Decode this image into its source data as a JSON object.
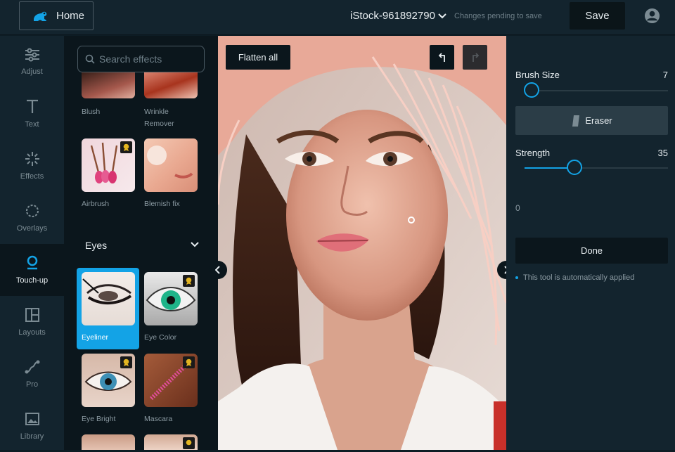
{
  "header": {
    "home_label": "Home",
    "file_title": "iStock-961892790",
    "pending_status": "Changes pending to save",
    "save_label": "Save"
  },
  "nav": {
    "items": [
      {
        "label": "Adjust",
        "icon": "sliders-icon"
      },
      {
        "label": "Text",
        "icon": "text-icon"
      },
      {
        "label": "Effects",
        "icon": "sparkle-icon"
      },
      {
        "label": "Overlays",
        "icon": "overlay-icon"
      },
      {
        "label": "Touch-up",
        "icon": "touchup-icon",
        "active": true
      },
      {
        "label": "Layouts",
        "icon": "layout-icon"
      },
      {
        "label": "Pro",
        "icon": "pro-icon"
      },
      {
        "label": "Library",
        "icon": "image-icon"
      }
    ]
  },
  "effects": {
    "search_placeholder": "Search effects",
    "tiles": [
      {
        "label": "Blush"
      },
      {
        "label": "Wrinkle Remover"
      },
      {
        "label": "Airbrush",
        "premium": true
      },
      {
        "label": "Blemish fix"
      },
      {
        "label": "Eyeliner",
        "selected": true
      },
      {
        "label": "Eye Color",
        "premium": true
      },
      {
        "label": "Eye Bright",
        "premium": true
      },
      {
        "label": "Mascara",
        "premium": true
      }
    ],
    "section_eyes": "Eyes"
  },
  "canvas": {
    "flatten_label": "Flatten all"
  },
  "panel": {
    "brush_size_label": "Brush Size",
    "brush_size_value": "7",
    "brush_size_fraction": 0.05,
    "eraser_label": "Eraser",
    "strength_label": "Strength",
    "strength_value": "35",
    "strength_fraction": 0.35,
    "zero_value": "0",
    "done_label": "Done",
    "note": "This tool is automatically applied"
  },
  "colors": {
    "accent": "#13a3e6",
    "topbar": "#13242e",
    "panel_dark": "#0b161c"
  }
}
